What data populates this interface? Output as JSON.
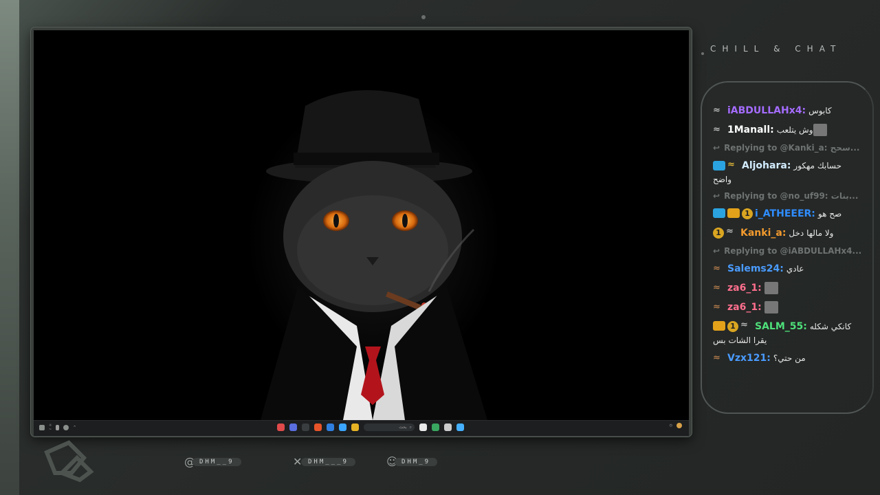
{
  "header": {
    "title": "CHILL & CHAT"
  },
  "taskbar": {
    "left_icons": [
      "start-icon",
      "weather-icon",
      "mic-icon",
      "cloud-icon",
      "chevron-up-icon"
    ],
    "center_apps": [
      {
        "name": "app-1",
        "color": "#e04a4a"
      },
      {
        "name": "app-2",
        "color": "#5a6ee0"
      },
      {
        "name": "app-3",
        "color": "#3a3d40"
      },
      {
        "name": "app-4",
        "color": "#e8542a"
      },
      {
        "name": "app-5",
        "color": "#2f7fe0"
      },
      {
        "name": "app-6",
        "color": "#3aa6ff"
      },
      {
        "name": "app-7",
        "color": "#e6b325"
      },
      {
        "name": "app-8",
        "color": "#e9e9e9"
      },
      {
        "name": "app-9",
        "color": "#3aa760"
      },
      {
        "name": "app-10",
        "color": "#ccc"
      }
    ],
    "windows_icon": "windows-icon",
    "search_placeholder": "بحث"
  },
  "chat": {
    "messages": [
      {
        "type": "msg",
        "badges": [
          "wing"
        ],
        "user": "iABDULLAHx4:",
        "color": "#a56cff",
        "text": "كابوس"
      },
      {
        "type": "msg",
        "badges": [
          "wing"
        ],
        "user": "1Manall:",
        "color": "#ffffff",
        "text": "وش يتلعب",
        "emote": true
      },
      {
        "type": "reply",
        "text": "Replying to @Kanki_a: سحح..."
      },
      {
        "type": "msg",
        "badges": [
          "hammer",
          "gold-wing"
        ],
        "user": "Aljohara:",
        "color": "#d3ecff",
        "text": "حسابك مهكور",
        "text2": "واضح"
      },
      {
        "type": "reply",
        "text": "Replying to @no_uf99: بنات..."
      },
      {
        "type": "msg",
        "badges": [
          "hammer",
          "crown",
          "sub"
        ],
        "user": "i_ATHEEER:",
        "color": "#2f8dff",
        "text": "صح هو"
      },
      {
        "type": "msg",
        "badges": [
          "sub",
          "wing"
        ],
        "user": "Kanki_a:",
        "color": "#f29a2e",
        "text": "ولا مالها دخل"
      },
      {
        "type": "reply",
        "text": "Replying to @iABDULLAHx4..."
      },
      {
        "type": "msg",
        "badges": [
          "copper-wing"
        ],
        "user": "Salems24:",
        "color": "#4a9bff",
        "text": "عادي"
      },
      {
        "type": "msg",
        "badges": [
          "copper-wing"
        ],
        "user": "za6_1:",
        "color": "#ff6f8e",
        "text": "",
        "emote": true
      },
      {
        "type": "msg",
        "badges": [
          "copper-wing"
        ],
        "user": "za6_1:",
        "color": "#ff6f8e",
        "text": "",
        "emote": true
      },
      {
        "type": "msg",
        "badges": [
          "crown",
          "sub",
          "wing"
        ],
        "user": "SALM_55:",
        "color": "#4ee07a",
        "text": "كانكي شكله",
        "text2": "يقرا الشات بس"
      },
      {
        "type": "msg",
        "badges": [
          "copper-wing"
        ],
        "user": "Vzx121:",
        "color": "#4a9bff",
        "text": "من حتي؟"
      }
    ]
  },
  "socials": [
    {
      "icon": "threads-icon",
      "handle": "DHM__9"
    },
    {
      "icon": "x-icon",
      "handle": "DHM___9"
    },
    {
      "icon": "snapchat-icon",
      "handle": "DHM_9"
    }
  ]
}
